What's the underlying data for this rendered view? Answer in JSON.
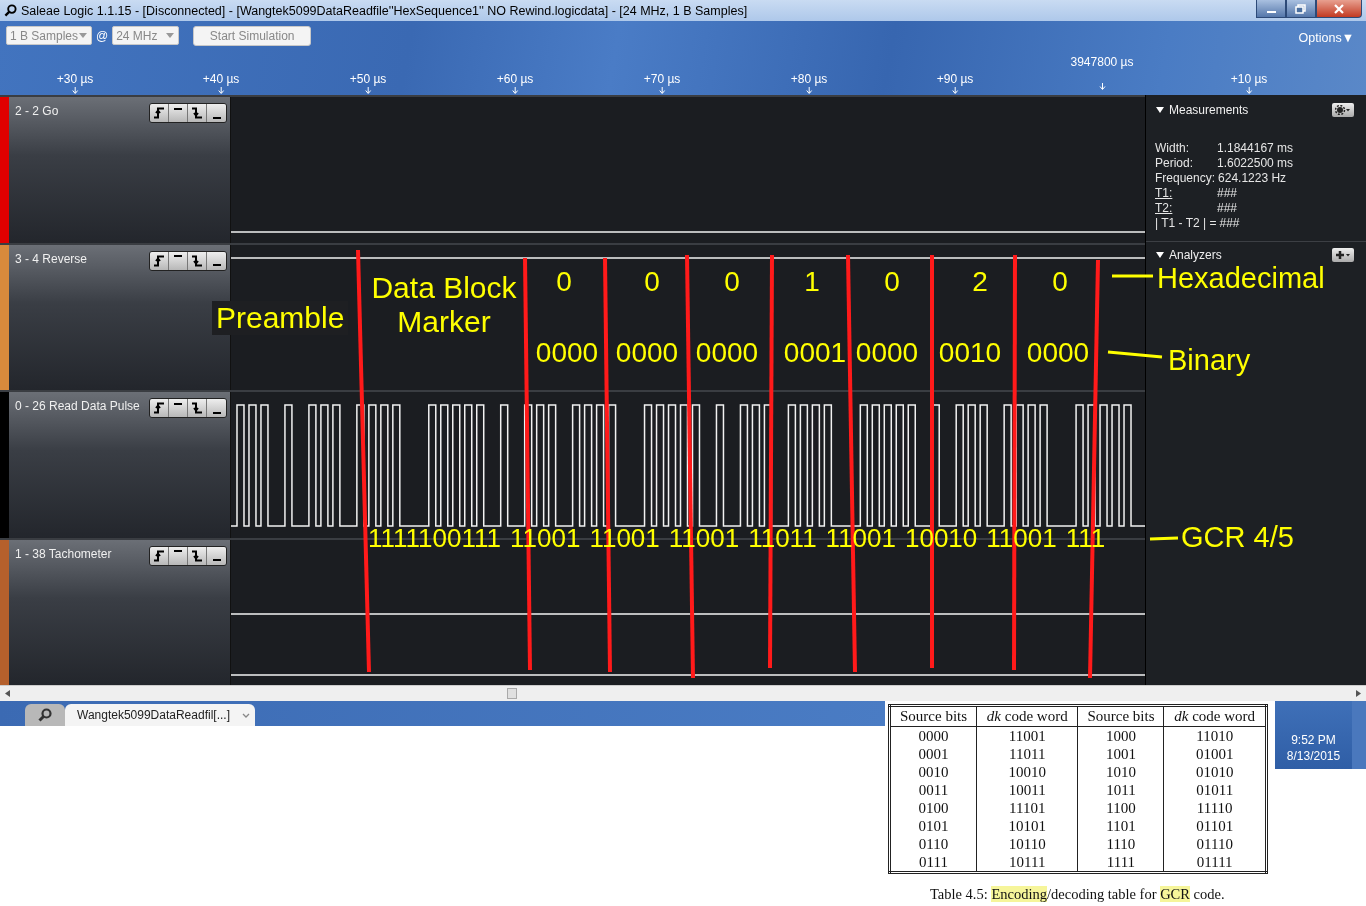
{
  "window": {
    "title": "Saleae Logic 1.1.15 - [Disconnected] - [Wangtek5099DataReadfile''HexSequence1'' NO Rewind.logicdata] - [24 MHz, 1 B Samples]"
  },
  "toolbar": {
    "samples": "1 B Samples",
    "at": "@",
    "rate": "24 MHz",
    "start_button": "Start Simulation",
    "options": "Options▼"
  },
  "ruler": {
    "origin": "3947800 µs",
    "ticks": [
      "+30 µs",
      "+40 µs",
      "+50 µs",
      "+60 µs",
      "+70 µs",
      "+80 µs",
      "+90 µs",
      "+10 µs"
    ]
  },
  "channels": [
    {
      "name": "2 - 2 Go",
      "color": "#e00000",
      "kind": "low"
    },
    {
      "name": "3 - 4 Reverse",
      "color": "#d88a3c",
      "kind": "high"
    },
    {
      "name": "0 - 26 Read Data Pulse",
      "color": "#000000",
      "kind": "pulses"
    },
    {
      "name": "1 - 38 Tachometer",
      "color": "#b5602c",
      "kind": "double"
    }
  ],
  "annotations": {
    "preamble": "Preamble",
    "marker": "Data Block Marker",
    "hex_label": "Hexadecimal",
    "binary_label": "Binary",
    "gcr_label": "GCR 4/5",
    "decoded": [
      {
        "hex": "0",
        "binary": "0000"
      },
      {
        "hex": "0",
        "binary": "0000"
      },
      {
        "hex": "0",
        "binary": "0000"
      },
      {
        "hex": "1",
        "binary": "0001"
      },
      {
        "hex": "0",
        "binary": "0000"
      },
      {
        "hex": "2",
        "binary": "0010"
      },
      {
        "hex": "0",
        "binary": "0000"
      }
    ],
    "gcr_bits": [
      "1111100111",
      "11001",
      "11001",
      "11001",
      "11011",
      "11001",
      "10010",
      "11001",
      "111"
    ]
  },
  "measurements": {
    "title": "Measurements",
    "rows": [
      {
        "label": "Width:",
        "value": "1.1844167 ms",
        "underlined": false
      },
      {
        "label": "Period:",
        "value": "1.6022500 ms",
        "underlined": false
      },
      {
        "label": "Frequency:",
        "value": "624.1223 Hz",
        "underlined": false
      },
      {
        "label": "T1:",
        "value": "###",
        "underlined": true
      },
      {
        "label": "T2:",
        "value": "###",
        "underlined": true
      },
      {
        "label": "| T1 - T2 | =",
        "value": "###",
        "underlined": false
      }
    ]
  },
  "analyzers": {
    "title": "Analyzers"
  },
  "tabs": [
    {
      "label": "Wangtek5099DataReadfil[...]",
      "selected": true
    }
  ],
  "table": {
    "columns": [
      "Source bits",
      "*dk* code word",
      "Source bits",
      "*dk* code word"
    ],
    "rows": [
      [
        "0000",
        "11001",
        "1000",
        "11010"
      ],
      [
        "0001",
        "11011",
        "1001",
        "01001"
      ],
      [
        "0010",
        "10010",
        "1010",
        "01010"
      ],
      [
        "0011",
        "10011",
        "1011",
        "01011"
      ],
      [
        "0100",
        "11101",
        "1100",
        "11110"
      ],
      [
        "0101",
        "10101",
        "1101",
        "01101"
      ],
      [
        "0110",
        "10110",
        "1110",
        "01110"
      ],
      [
        "0111",
        "10111",
        "1111",
        "01111"
      ]
    ],
    "caption": [
      {
        "text": "Table 4.5: ",
        "highlighted": false
      },
      {
        "text": "Encoding",
        "highlighted": true
      },
      {
        "text": "/decoding table for ",
        "highlighted": false
      },
      {
        "text": "GCR",
        "highlighted": true
      },
      {
        "text": " code.",
        "highlighted": false
      }
    ]
  },
  "clock": {
    "time": "9:52 PM",
    "date": "8/13/2015"
  }
}
